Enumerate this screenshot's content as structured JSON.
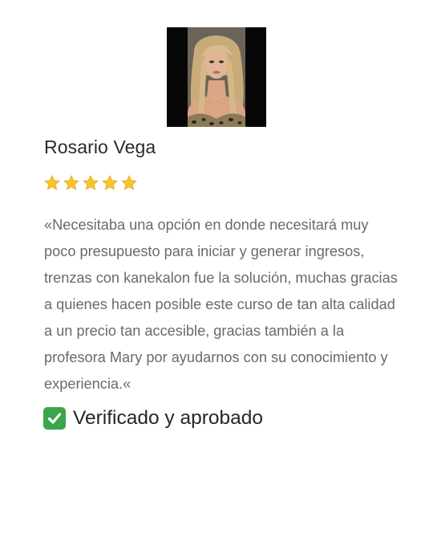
{
  "testimonial": {
    "reviewer_name": "Rosario Vega",
    "rating": 5,
    "rating_max": 5,
    "quote": "«Necesitaba una opción en donde necesitará muy poco presupuesto para iniciar y generar ingresos, trenzas con kanekalon fue la solución, muchas gracias a quienes hacen posible este curso de tan alta calidad a un precio tan accesible, gracias también a la profesora Mary por ayudarnos con su conocimiento y experiencia.«",
    "verified_label": "Verificado y aprobado",
    "verified_icon": "check-mark-button-icon",
    "colors": {
      "star": "#f7c52b",
      "verified_check_bg": "#3aa64a",
      "name_text": "#2b2b2b",
      "quote_text": "#6a6a6a"
    }
  }
}
